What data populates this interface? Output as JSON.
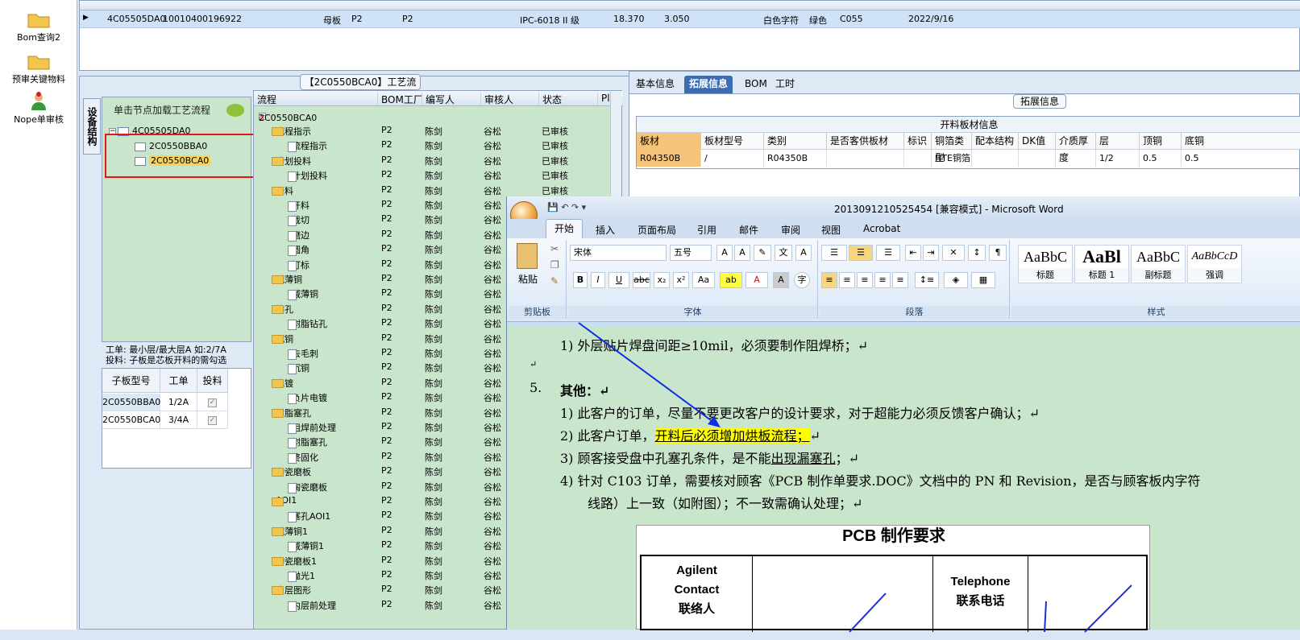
{
  "nav": {
    "items": [
      {
        "label": "Bom查询2"
      },
      {
        "label": "预审关键物料"
      },
      {
        "label": "Nope单审核"
      }
    ]
  },
  "top_grid": {
    "row": [
      "4C05505DA0",
      "10010400196922",
      "母板",
      "P2",
      "P2",
      "IPC-6018 II 级",
      "18.370",
      "3.050",
      "白色字符",
      "绿色",
      "C055",
      "2022/9/16"
    ]
  },
  "process": {
    "title": "【2C0550BCA0】工艺流程",
    "vtab": "设备结构",
    "hint": "单击节点加载工艺流程",
    "tree": {
      "root": "4C05505DA0",
      "children": [
        "2C0550BBA0",
        "2C0550BCA0"
      ]
    },
    "info1": "工单: 最小层/最大层A 如:2/7A",
    "info2": "投料: 子板是芯板开料的需勾选",
    "subtable": {
      "headers": [
        "子板型号",
        "工单",
        "投料"
      ],
      "rows": [
        [
          "2C0550BBA0",
          "1/2A",
          "✓"
        ],
        [
          "2C0550BCA0",
          "3/4A",
          "✓"
        ]
      ]
    }
  },
  "flow": {
    "headers": [
      "流程",
      "BOM工厂",
      "编写人",
      "审核人",
      "状态",
      "Pl"
    ],
    "root": "2C0550BCA0",
    "rows": [
      {
        "name": "流程指示",
        "level": 1,
        "f": "P2",
        "w": "陈剑",
        "r": "谷松",
        "s": "已审核"
      },
      {
        "name": "流程指示",
        "level": 2,
        "f": "P2",
        "w": "陈剑",
        "r": "谷松",
        "s": "已审核"
      },
      {
        "name": "计划投料",
        "level": 1,
        "f": "P2",
        "w": "陈剑",
        "r": "谷松",
        "s": "已审核"
      },
      {
        "name": "计划投料",
        "level": 2,
        "f": "P2",
        "w": "陈剑",
        "r": "谷松",
        "s": "已审核"
      },
      {
        "name": "开料",
        "level": 1,
        "f": "P2",
        "w": "陈剑",
        "r": "谷松",
        "s": "已审核"
      },
      {
        "name": "开料",
        "level": 2,
        "f": "P2",
        "w": "陈剑",
        "r": "谷松",
        "s": ""
      },
      {
        "name": "裁切",
        "level": 2,
        "f": "P2",
        "w": "陈剑",
        "r": "谷松",
        "s": ""
      },
      {
        "name": "磨边",
        "level": 2,
        "f": "P2",
        "w": "陈剑",
        "r": "谷松",
        "s": ""
      },
      {
        "name": "圆角",
        "level": 2,
        "f": "P2",
        "w": "陈剑",
        "r": "谷松",
        "s": ""
      },
      {
        "name": "打标",
        "level": 2,
        "f": "P2",
        "w": "陈剑",
        "r": "谷松",
        "s": ""
      },
      {
        "name": "减薄铜",
        "level": 1,
        "f": "P2",
        "w": "陈剑",
        "r": "谷松",
        "s": ""
      },
      {
        "name": "减薄铜",
        "level": 2,
        "f": "P2",
        "w": "陈剑",
        "r": "谷松",
        "s": ""
      },
      {
        "name": "钻孔",
        "level": 1,
        "f": "P2",
        "w": "陈剑",
        "r": "谷松",
        "s": ""
      },
      {
        "name": "树脂钻孔",
        "level": 2,
        "f": "P2",
        "w": "陈剑",
        "r": "谷松",
        "s": ""
      },
      {
        "name": "沉铜",
        "level": 1,
        "f": "P2",
        "w": "陈剑",
        "r": "谷松",
        "s": ""
      },
      {
        "name": "去毛刺",
        "level": 2,
        "f": "P2",
        "w": "陈剑",
        "r": "谷松",
        "s": ""
      },
      {
        "name": "沉铜",
        "level": 2,
        "f": "P2",
        "w": "陈剑",
        "r": "谷松",
        "s": ""
      },
      {
        "name": "电镀",
        "level": 1,
        "f": "P2",
        "w": "陈剑",
        "r": "谷松",
        "s": ""
      },
      {
        "name": "负片电镀",
        "level": 2,
        "f": "P2",
        "w": "陈剑",
        "r": "谷松",
        "s": ""
      },
      {
        "name": "树脂塞孔",
        "level": 1,
        "f": "P2",
        "w": "陈剑",
        "r": "谷松",
        "s": ""
      },
      {
        "name": "阻焊前处理",
        "level": 2,
        "f": "P2",
        "w": "陈剑",
        "r": "谷松",
        "s": ""
      },
      {
        "name": "树脂塞孔",
        "level": 2,
        "f": "P2",
        "w": "陈剑",
        "r": "谷松",
        "s": ""
      },
      {
        "name": "终固化",
        "level": 2,
        "f": "P2",
        "w": "陈剑",
        "r": "谷松",
        "s": ""
      },
      {
        "name": "陶瓷磨板",
        "level": 1,
        "f": "P2",
        "w": "陈剑",
        "r": "谷松",
        "s": ""
      },
      {
        "name": "陶瓷磨板",
        "level": 2,
        "f": "P2",
        "w": "陈剑",
        "r": "谷松",
        "s": ""
      },
      {
        "name": "AOI1",
        "level": 1,
        "f": "P2",
        "w": "陈剑",
        "r": "谷松",
        "s": ""
      },
      {
        "name": "塞孔AOI1",
        "level": 2,
        "f": "P2",
        "w": "陈剑",
        "r": "谷松",
        "s": ""
      },
      {
        "name": "减薄铜1",
        "level": 1,
        "f": "P2",
        "w": "陈剑",
        "r": "谷松",
        "s": ""
      },
      {
        "name": "减薄铜1",
        "level": 2,
        "f": "P2",
        "w": "陈剑",
        "r": "谷松",
        "s": ""
      },
      {
        "name": "陶瓷磨板1",
        "level": 1,
        "f": "P2",
        "w": "陈剑",
        "r": "谷松",
        "s": ""
      },
      {
        "name": "抛光1",
        "level": 2,
        "f": "P2",
        "w": "陈剑",
        "r": "谷松",
        "s": ""
      },
      {
        "name": "内层图形",
        "level": 1,
        "f": "P2",
        "w": "陈剑",
        "r": "谷松",
        "s": ""
      },
      {
        "name": "内层前处理",
        "level": 2,
        "f": "P2",
        "w": "陈剑",
        "r": "谷松",
        "s": ""
      }
    ]
  },
  "right": {
    "tabs": [
      "基本信息",
      "拓展信息",
      "BOM",
      "工时"
    ],
    "ext_label": "拓展信息",
    "table_caption": "开料板材信息",
    "headers": [
      "板材",
      "板材型号",
      "类别",
      "是否客供板材",
      "标识",
      "铜箔类型",
      "配本结构",
      "DK值",
      "介质厚度",
      "层",
      "顶铜",
      "底铜"
    ],
    "row": [
      "R04350B",
      "/",
      "R04350B",
      "",
      "",
      "HTE铜箔",
      "",
      "",
      "",
      "1/2",
      "0.5",
      "0.5"
    ]
  },
  "word": {
    "title": "201309121052545​4 [兼容模式] - Microsoft Word",
    "tabs": [
      "开始",
      "插入",
      "页面布局",
      "引用",
      "邮件",
      "审阅",
      "视图",
      "Acrobat"
    ],
    "font_name": "宋体",
    "font_size": "五号",
    "paste": "粘贴",
    "groups": [
      "剪贴板",
      "字体",
      "段落",
      "样式"
    ],
    "styles": [
      {
        "pv": "AaBbC",
        "nm": "标题"
      },
      {
        "pv": "AaBl",
        "nm": "标题 1"
      },
      {
        "pv": "AaBbC",
        "nm": "副标题"
      },
      {
        "pv": "AaBbCcD",
        "nm": "强调"
      }
    ],
    "lines": {
      "l1": "1)  外层贴片焊盘间距≥10mil，必须要制作阻焊桥；↵",
      "l2": "↵",
      "h5n": "5.",
      "h5": "其他：↵",
      "p1": "1)  此客户的订单，尽量不要更改客户的设计要求，对于超能力必须反馈客户确认；↵",
      "p2a": "2)  此客户订单，",
      "p2b": "开料后必须增加烘板流程；",
      "p2c": "↵",
      "p3a": "3)  顾客接受盘中孔塞孔条件，是不能",
      "p3b": "出现漏塞孔",
      "p3c": "；↵",
      "p4": "4)  针对 C103 订单，需要核对顾客《PCB 制作单要求.DOC》文档中的 PN 和 Revision，是否与顾客板内字符",
      "p4b": "线路）上一致（如附图）；不一致需确认处理；↵"
    },
    "pcb_title": "PCB 制作要求",
    "pcb_c1": "Agilent\nContact\n联络人",
    "pcb_c2": "Telephone\n联系电话"
  }
}
